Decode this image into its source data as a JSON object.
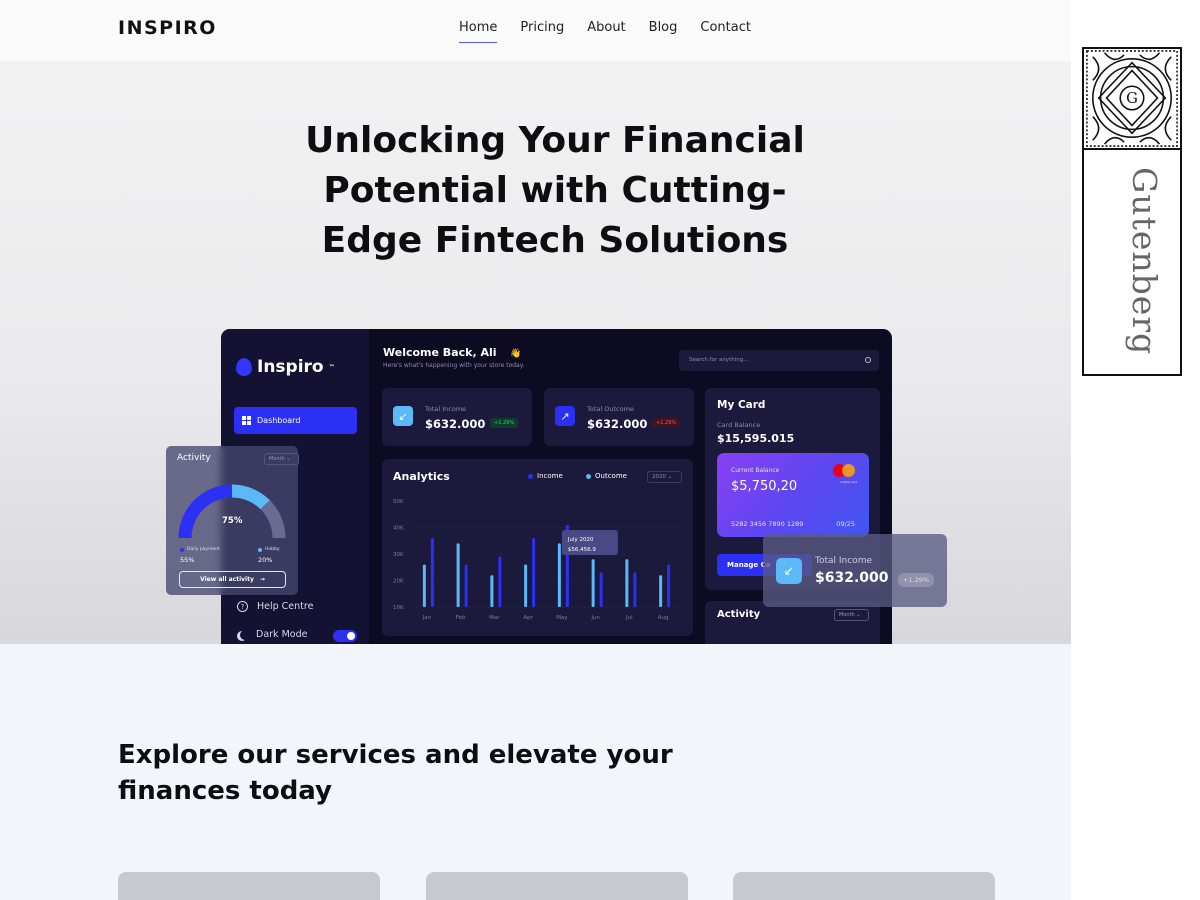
{
  "site": {
    "logo": "INSPIRO",
    "nav": [
      {
        "label": "Home",
        "active": true
      },
      {
        "label": "Pricing"
      },
      {
        "label": "About"
      },
      {
        "label": "Blog"
      },
      {
        "label": "Contact"
      }
    ]
  },
  "hero": {
    "title_line1": "Unlocking Your Financial",
    "title_line2": "Potential with Cutting-",
    "title_line3": "Edge Fintech Solutions"
  },
  "dashboard": {
    "brand": "Inspiro",
    "brand_mark": "™",
    "nav_active": "Dashboard",
    "help": "Help Centre",
    "dark_mode": "Dark Mode",
    "dark_mode_on": true,
    "welcome": "Welcome Back, Ali",
    "welcome_emoji": "👋",
    "welcome_sub": "Here's what's happening with your store today.",
    "search_placeholder": "Search for anything...",
    "stats": [
      {
        "label": "Total Income",
        "value": "$632.000",
        "badge": "+1.29%",
        "icon": "arrow-down-left-icon",
        "color": "#5ab9f6"
      },
      {
        "label": "Total Outcome",
        "value": "$632.000",
        "badge": "+1.29%",
        "icon": "arrow-up-right-icon",
        "color": "#2b30f4"
      }
    ],
    "analytics": {
      "title": "Analytics",
      "legend_income": "Income",
      "legend_outcome": "Outcome",
      "year": "2020",
      "tooltip_date": "July 2020",
      "tooltip_value": "$56,456.9"
    },
    "my_card": {
      "title": "My Card",
      "balance_label": "Card Balance",
      "balance": "$15,595.015",
      "current_label": "Current Balance",
      "current_value": "$5,750,20",
      "number": "5282 3456 7890 1289",
      "expiry": "09/25",
      "network_label": "mastercard",
      "manage": "Manage Ca"
    },
    "activity_section": {
      "title": "Activity",
      "period": "Month"
    }
  },
  "activity_card": {
    "title": "Activity",
    "period": "Month",
    "percent": "75%",
    "gauge_fraction": 0.75,
    "legend": [
      {
        "label": "Daily payment",
        "value": "55%",
        "color": "#2b30f4"
      },
      {
        "label": "Hobby",
        "value": "20%",
        "color": "#5ab9f6"
      }
    ],
    "button": "View all activity"
  },
  "income_card": {
    "label": "Total Income",
    "value": "$632.000",
    "badge": "+1.29%"
  },
  "services": {
    "title_line1": "Explore our services and elevate your",
    "title_line2": "finances today"
  },
  "badge": {
    "word": "Gutenberg"
  },
  "colors": {
    "accent": "#4e5af5",
    "dashboard_bg": "#0c0b21",
    "income": "#2b30f4",
    "outcome": "#5ab9f6"
  },
  "chart_data": {
    "type": "bar",
    "title": "Analytics",
    "categories": [
      "Jan",
      "Feb",
      "Mar",
      "Apr",
      "May",
      "Jun",
      "Jul",
      "Aug"
    ],
    "y_ticks": [
      "50K",
      "40K",
      "30K",
      "20K",
      "10K"
    ],
    "ylim": [
      10000,
      50000
    ],
    "series": [
      {
        "name": "Outcome",
        "color": "#5ab9f6",
        "values": [
          26000,
          34000,
          22000,
          26000,
          34000,
          28000,
          28000,
          22000
        ]
      },
      {
        "name": "Income",
        "color": "#2b30f4",
        "values": [
          36000,
          26000,
          29000,
          36000,
          41000,
          23000,
          23000,
          26000
        ]
      }
    ]
  }
}
